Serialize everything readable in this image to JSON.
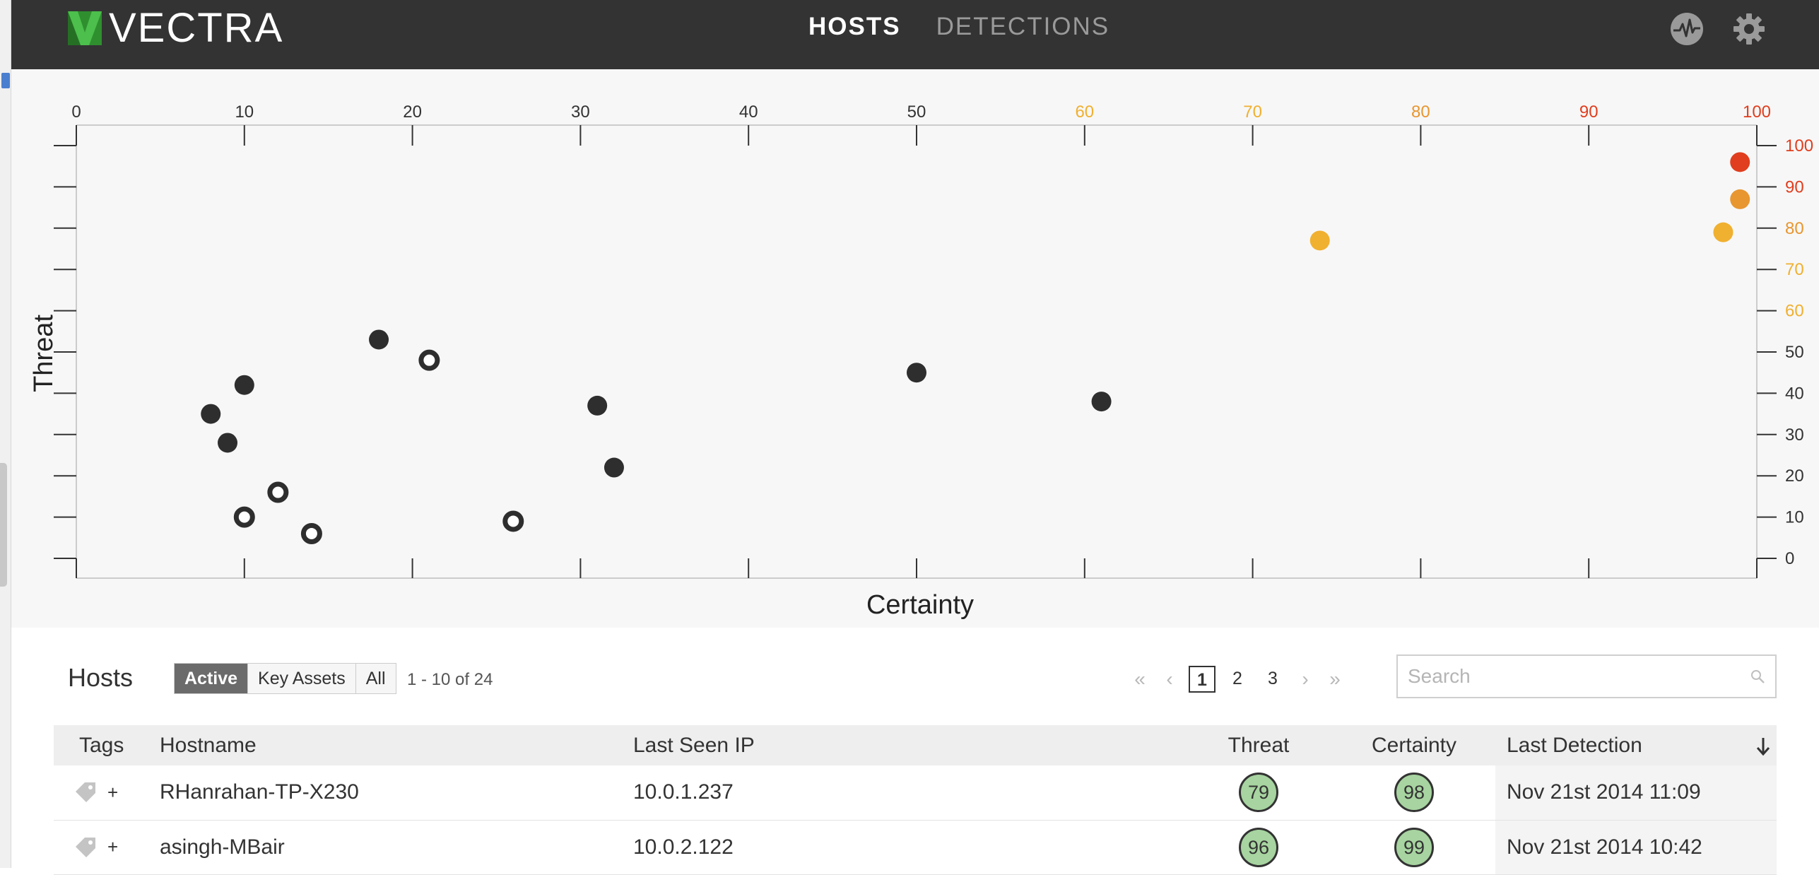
{
  "app": {
    "brand": "VECTRA",
    "nav_tabs": [
      {
        "label": "HOSTS",
        "active": true
      },
      {
        "label": "DETECTIONS",
        "active": false
      }
    ],
    "icons": {
      "activity": "pulse-icon",
      "settings": "gear-icon"
    },
    "colors": {
      "topbar": "#333333",
      "brand_green": "#3aa63a"
    }
  },
  "chart_data": {
    "type": "scatter",
    "xlabel": "Certainty",
    "ylabel": "Threat",
    "xlim": [
      0,
      100
    ],
    "ylim": [
      0,
      100
    ],
    "x_ticks": [
      0,
      10,
      20,
      30,
      40,
      50,
      60,
      70,
      80,
      90,
      100
    ],
    "y_ticks": [
      0,
      10,
      20,
      30,
      40,
      50,
      60,
      70,
      80,
      90,
      100
    ],
    "tick_colors": {
      "normal": "#333333",
      "medium": "#f0b030",
      "high": "#e89630",
      "critical": "#e03e1e"
    },
    "points": [
      {
        "x": 99,
        "y": 96,
        "style": "critical"
      },
      {
        "x": 99,
        "y": 87,
        "style": "high"
      },
      {
        "x": 98,
        "y": 79,
        "style": "medium"
      },
      {
        "x": 74,
        "y": 77,
        "style": "medium"
      },
      {
        "x": 18,
        "y": 53,
        "style": "filled"
      },
      {
        "x": 21,
        "y": 48,
        "style": "ring"
      },
      {
        "x": 50,
        "y": 45,
        "style": "filled"
      },
      {
        "x": 10,
        "y": 42,
        "style": "filled"
      },
      {
        "x": 61,
        "y": 38,
        "style": "filled"
      },
      {
        "x": 31,
        "y": 37,
        "style": "filled"
      },
      {
        "x": 8,
        "y": 35,
        "style": "filled"
      },
      {
        "x": 9,
        "y": 28,
        "style": "filled"
      },
      {
        "x": 32,
        "y": 22,
        "style": "filled"
      },
      {
        "x": 12,
        "y": 16,
        "style": "ring"
      },
      {
        "x": 10,
        "y": 10,
        "style": "ring"
      },
      {
        "x": 26,
        "y": 9,
        "style": "ring"
      },
      {
        "x": 14,
        "y": 6,
        "style": "ring"
      }
    ],
    "grid": false
  },
  "hosts": {
    "title": "Hosts",
    "filters": [
      {
        "label": "Active",
        "active": true
      },
      {
        "label": "Key Assets",
        "active": false
      },
      {
        "label": "All",
        "active": false
      }
    ],
    "range_text": "1 - 10 of 24",
    "pager": {
      "first": "«",
      "prev": "‹",
      "pages": [
        "1",
        "2",
        "3"
      ],
      "current": "1",
      "next": "›",
      "last": "»"
    },
    "search": {
      "placeholder": "Search",
      "value": ""
    },
    "columns": [
      "Tags",
      "Hostname",
      "Last Seen IP",
      "Threat",
      "Certainty",
      "Last Detection"
    ],
    "add_tag_label": "+",
    "rows": [
      {
        "hostname": "RHanrahan-TP-X230",
        "ip": "10.0.1.237",
        "threat": "79",
        "certainty": "98",
        "last_detection": "Nov 21st 2014 11:09"
      },
      {
        "hostname": "asingh-MBair",
        "ip": "10.0.2.122",
        "threat": "96",
        "certainty": "99",
        "last_detection": "Nov 21st 2014 10:42"
      }
    ],
    "score_color": "#a7d4a0"
  }
}
